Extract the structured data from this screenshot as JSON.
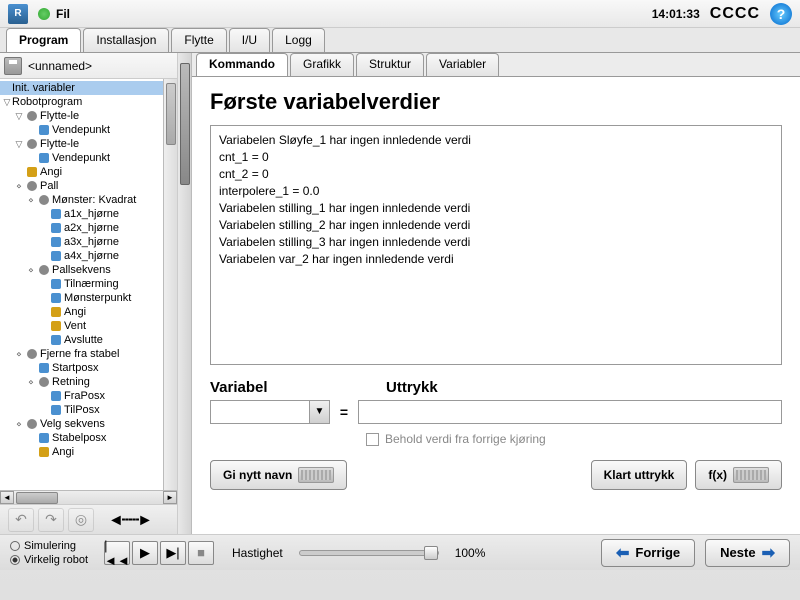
{
  "topbar": {
    "file_label": "Fil",
    "clock": "14:01:33",
    "status": "CCCC"
  },
  "main_tabs": [
    "Program",
    "Installasjon",
    "Flytte",
    "I/U",
    "Logg"
  ],
  "main_tab_active": 0,
  "filename": "<unnamed>",
  "tree": [
    {
      "lvl": 0,
      "label": "Init. variabler",
      "sel": true,
      "exp": "",
      "ico": ""
    },
    {
      "lvl": 0,
      "label": "Robotprogram",
      "exp": "▽",
      "ico": ""
    },
    {
      "lvl": 1,
      "label": "Flytte-le",
      "exp": "▽",
      "ico": "hex"
    },
    {
      "lvl": 2,
      "label": "Vendepunkt",
      "exp": "",
      "ico": "blue"
    },
    {
      "lvl": 1,
      "label": "Flytte-le",
      "exp": "▽",
      "ico": "hex"
    },
    {
      "lvl": 2,
      "label": "Vendepunkt",
      "exp": "",
      "ico": "blue"
    },
    {
      "lvl": 1,
      "label": "Angi",
      "exp": "",
      "ico": "yellow"
    },
    {
      "lvl": 1,
      "label": "Pall",
      "exp": "⋄",
      "ico": "hex"
    },
    {
      "lvl": 2,
      "label": "Mønster: Kvadrat",
      "exp": "⋄",
      "ico": "hex"
    },
    {
      "lvl": 3,
      "label": "a1x_hjørne",
      "exp": "",
      "ico": "blue"
    },
    {
      "lvl": 3,
      "label": "a2x_hjørne",
      "exp": "",
      "ico": "blue"
    },
    {
      "lvl": 3,
      "label": "a3x_hjørne",
      "exp": "",
      "ico": "blue"
    },
    {
      "lvl": 3,
      "label": "a4x_hjørne",
      "exp": "",
      "ico": "blue"
    },
    {
      "lvl": 2,
      "label": "Pallsekvens",
      "exp": "⋄",
      "ico": "hex"
    },
    {
      "lvl": 3,
      "label": "Tilnærming",
      "exp": "",
      "ico": "blue"
    },
    {
      "lvl": 3,
      "label": "Mønsterpunkt",
      "exp": "",
      "ico": "blue"
    },
    {
      "lvl": 3,
      "label": "Angi",
      "exp": "",
      "ico": "yellow"
    },
    {
      "lvl": 3,
      "label": "Vent",
      "exp": "",
      "ico": "yellow"
    },
    {
      "lvl": 3,
      "label": "Avslutte",
      "exp": "",
      "ico": "blue"
    },
    {
      "lvl": 1,
      "label": "Fjerne fra stabel",
      "exp": "⋄",
      "ico": "hex"
    },
    {
      "lvl": 2,
      "label": "Startposx",
      "exp": "",
      "ico": "blue"
    },
    {
      "lvl": 2,
      "label": "Retning",
      "exp": "⋄",
      "ico": "hex"
    },
    {
      "lvl": 3,
      "label": "FraPosx",
      "exp": "",
      "ico": "blue"
    },
    {
      "lvl": 3,
      "label": "TilPosx",
      "exp": "",
      "ico": "blue"
    },
    {
      "lvl": 1,
      "label": "Velg sekvens",
      "exp": "⋄",
      "ico": "hex"
    },
    {
      "lvl": 2,
      "label": "Stabelposx",
      "exp": "",
      "ico": "blue"
    },
    {
      "lvl": 2,
      "label": "Angi",
      "exp": "",
      "ico": "yellow"
    }
  ],
  "sub_tabs": [
    "Kommando",
    "Grafikk",
    "Struktur",
    "Variabler"
  ],
  "sub_tab_active": 0,
  "heading": "Første variabelverdier",
  "var_lines": [
    "Variabelen Sløyfe_1 har ingen innledende verdi",
    "cnt_1 = 0",
    "cnt_2 = 0",
    "interpolere_1 = 0.0",
    "Variabelen stilling_1 har ingen innledende verdi",
    "Variabelen stilling_2 har ingen innledende verdi",
    "Variabelen stilling_3 har ingen innledende verdi",
    "Variabelen var_2 har ingen innledende verdi"
  ],
  "labels": {
    "variable": "Variabel",
    "expression": "Uttrykk",
    "keep": "Behold verdi fra forrige kjøring"
  },
  "buttons": {
    "rename": "Gi nytt navn",
    "clear": "Klart uttrykk",
    "fx": "f(x)",
    "prev": "Forrige",
    "next": "Neste"
  },
  "bottom": {
    "sim": "Simulering",
    "real": "Virkelig robot",
    "speed_label": "Hastighet",
    "speed_value": "100%"
  }
}
